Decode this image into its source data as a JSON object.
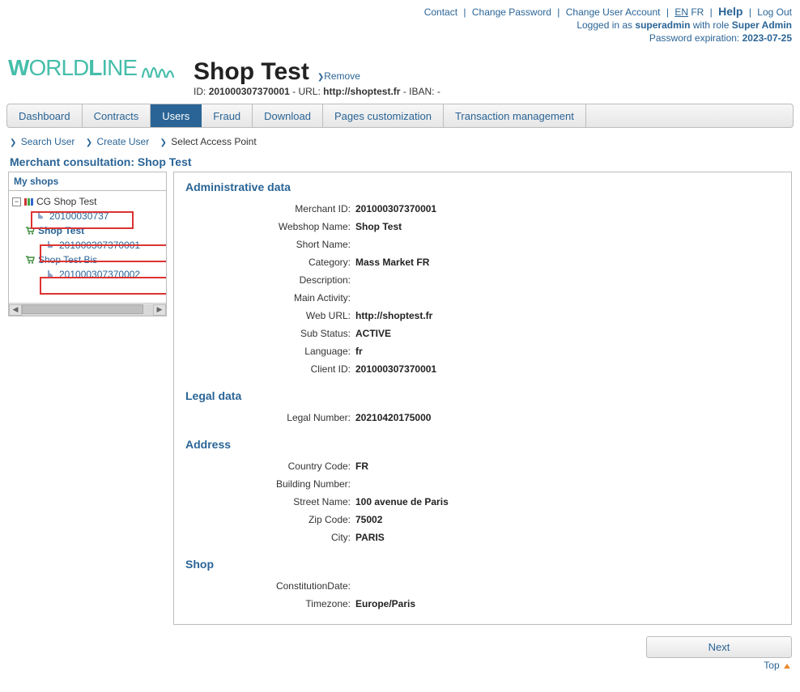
{
  "top": {
    "contact": "Contact",
    "change_password": "Change Password",
    "change_user_account": "Change User Account",
    "lang_en": "EN",
    "lang_fr": "FR",
    "help": "Help",
    "logout": "Log Out",
    "logged_prefix": "Logged in as ",
    "logged_user": "superadmin",
    "logged_mid": " with role ",
    "logged_role": "Super Admin",
    "pw_prefix": "Password expiration: ",
    "pw_date": "2023-07-25"
  },
  "logo": "WORLDLINE",
  "shop": {
    "title": "Shop Test",
    "remove": "Remove",
    "subline": "ID: 201000307370001 - URL: http://shoptest.fr - IBAN: -",
    "id_label": "ID: ",
    "id_value": "201000307370001",
    "url_label": " - URL: ",
    "url_value": "http://shoptest.fr",
    "iban_label": " - IBAN: -"
  },
  "tabs": [
    "Dashboard",
    "Contracts",
    "Users",
    "Fraud",
    "Download",
    "Pages customization",
    "Transaction management"
  ],
  "active_tab": 2,
  "subnav": {
    "search_user": "Search User",
    "create_user": "Create User",
    "select_ap": "Select Access Point"
  },
  "page_heading": "Merchant consultation: Shop Test",
  "sidebar": {
    "title": "My shops",
    "root": "CG Shop Test",
    "root_child": "20100030737",
    "shop1": "Shop Test",
    "shop1_child": "201000307370001",
    "shop2": "Shop Test Bis",
    "shop2_child": "201000307370002"
  },
  "admin": {
    "heading": "Administrative data",
    "rows": [
      {
        "label": "Merchant ID:",
        "value": "201000307370001"
      },
      {
        "label": "Webshop Name:",
        "value": "Shop Test"
      },
      {
        "label": "Short Name:",
        "value": ""
      },
      {
        "label": "Category:",
        "value": "Mass Market FR"
      },
      {
        "label": "Description:",
        "value": ""
      },
      {
        "label": "Main Activity:",
        "value": ""
      },
      {
        "label": "Web URL:",
        "value": "http://shoptest.fr"
      },
      {
        "label": "Sub Status:",
        "value": "ACTIVE"
      },
      {
        "label": "Language:",
        "value": "fr"
      },
      {
        "label": "Client ID:",
        "value": "201000307370001"
      }
    ]
  },
  "legal": {
    "heading": "Legal data",
    "rows": [
      {
        "label": "Legal Number:",
        "value": "20210420175000"
      }
    ]
  },
  "address": {
    "heading": "Address",
    "rows": [
      {
        "label": "Country Code:",
        "value": "FR"
      },
      {
        "label": "Building Number:",
        "value": ""
      },
      {
        "label": "Street Name:",
        "value": "100 avenue de Paris"
      },
      {
        "label": "Zip Code:",
        "value": "75002"
      },
      {
        "label": "City:",
        "value": "PARIS"
      }
    ]
  },
  "shop_section": {
    "heading": "Shop",
    "rows": [
      {
        "label": "ConstitutionDate:",
        "value": ""
      },
      {
        "label": "Timezone:",
        "value": "Europe/Paris"
      }
    ]
  },
  "next_button": "Next",
  "top_link": "Top"
}
